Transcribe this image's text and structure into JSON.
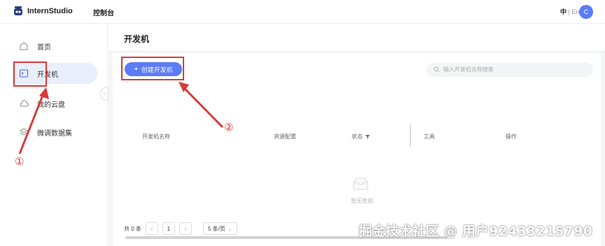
{
  "app": {
    "name": "InternStudio",
    "console_label": "控制台",
    "lang_zh": "中",
    "lang_sep": " | ",
    "lang_en": "En",
    "avatar_letter": "C"
  },
  "sidebar": {
    "items": [
      {
        "label": "首页",
        "icon": "home-icon"
      },
      {
        "label": "开发机",
        "icon": "terminal-icon",
        "active": true
      },
      {
        "label": "我的云盘",
        "icon": "cloud-icon"
      },
      {
        "label": "微调数据集",
        "icon": "layers-icon"
      }
    ],
    "collapse_glyph": "‹"
  },
  "main": {
    "title": "开发机",
    "create_button": "创建开发机",
    "search_placeholder": "输入开发机名称搜索",
    "table": {
      "columns": [
        "开发机名称",
        "资源配置",
        "状态",
        "工具",
        "操作"
      ],
      "empty_text": "暂无数据"
    },
    "pagination": {
      "total": "共 0 条",
      "current_page": "1",
      "page_size": "5 条/页"
    }
  },
  "annotations": {
    "step1": "①",
    "step2": "②",
    "color": "#d93a3a"
  },
  "watermark": "掘金技术社区 @ 用户92433215790",
  "colors": {
    "accent": "#5b7cf6",
    "active_bg": "#e9eefc"
  }
}
